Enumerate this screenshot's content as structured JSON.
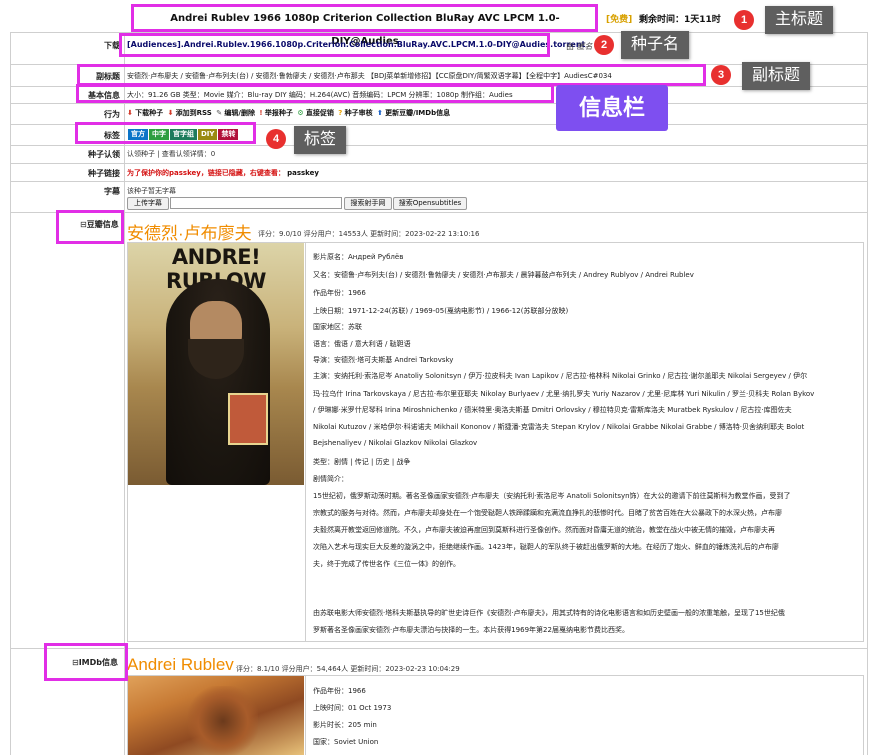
{
  "header": {
    "main_title": "Andrei Rublev 1966 1080p Criterion Collection BluRay AVC LPCM 1.0-DIY@Audies",
    "free_tag": "[免费]",
    "remaining_label": "剩余时间：",
    "remaining_value": "1天11时"
  },
  "annotations": {
    "main_title": "主标题",
    "torrent_name": "种子名",
    "subtitle": "副标题",
    "info_bar": "信息栏",
    "tags": "标签",
    "nums": [
      "1",
      "2",
      "3",
      "4"
    ]
  },
  "rows": {
    "download_label": "下载",
    "torrent_file": "[Audiences].Andrei.Rublev.1966.1080p.Criterion.Collection.BluRay.AVC.LPCM.1.0-DIY@Audies.torrent",
    "uploader_prefix": "由",
    "uploader_name": "匿名",
    "subtitle_label": "副标题",
    "subtitle_text": "安德烈·卢布廖夫 / 安德鲁·卢布列夫(台) / 安德烈·鲁勃廖夫 / 安德烈·卢布那夫 【BDJ菜单新增修招】【CC原盘DIY/简繁双语字幕】【全程中字】AudiesC#034",
    "info_label": "基本信息",
    "info_text": "大小：91.26 GB   类型：Movie   媒介：Blu-ray DIY   编码：H.264(AVC)   音频编码：LPCM   分辨率：1080p   制作组：Audies",
    "action_label": "行为",
    "actions": [
      "下载种子",
      "添加到RSS",
      "编辑/删除",
      "举报种子",
      "直接促销",
      "种子审核",
      "更新豆瓣/IMDb信息"
    ],
    "tags_label": "标签",
    "tags": [
      {
        "text": "官方",
        "color": "#0b74c8"
      },
      {
        "text": "中字",
        "color": "#2e9e40"
      },
      {
        "text": "官字组",
        "color": "#1d7b5c"
      },
      {
        "text": "DIY",
        "color": "#9a8a12"
      },
      {
        "text": "禁转",
        "color": "#b1113a"
      }
    ],
    "claim_label": "种子认领",
    "claim_text": "认领种子 | 查看认领详情：0",
    "link_label": "种子链接",
    "link_warning": "为了保护你的passkey，链接已隐藏，右键查看：",
    "link_value": "passkey",
    "subs_label": "字幕",
    "subs_none": "该种子暂无字幕",
    "upload_sub_btn": "上传字幕",
    "search_sub_btn": "搜索射手网",
    "search_opensub_btn": "搜索Opensubtitles"
  },
  "douban": {
    "section_label": "豆瓣信息",
    "title": "安德烈·卢布廖夫",
    "rating_text": "评分：9.0/10  评分用户：14553人  更新时间：2023-02-22 13:10:16",
    "poster_title": "ANDRE! RUBLOW",
    "lines": [
      "影片原名：Андрей Рублёв",
      "又名：安德鲁·卢布列夫(台) / 安德烈·鲁勃廖夫 / 安德烈·卢布那夫 / 晨钟暮鼓卢布列夫 / Andrey Rublyov / Andrei Rublev",
      "作品年份：1966",
      "上映日期：1971-12-24(苏联) / 1969-05(戛纳电影节) / 1966-12(苏联部分放映)",
      "国家地区：苏联",
      "语言：俄语 / 意大利语 / 鞑靼语",
      "导演：安德烈·塔可夫斯基 Andrei Tarkovsky",
      "主演：安纳托利·索洛尼岑 Anatoliy Solonitsyn / 伊万·拉皮科夫 Ivan Lapikov / 尼古拉·格林科 Nikolai Grinko / 尼古拉·谢尔盖耶夫 Nikolai Sergeyev / 伊尔",
      "玛·拉乌什 Irina Tarkovskaya / 尼古拉·布尔里亚耶夫 Nikolay Burlyaev / 尤里·纳扎罗夫 Yuriy Nazarov / 尤里·尼库林 Yuri Nikulin / 罗兰·贝科夫 Rolan Bykov",
      "/ 伊琳娜·米罗什尼琴科 Irina Miroshnichenko / 德米特里·奥洛夫斯基 Dmitri Orlovsky / 穆拉特贝克·雷斯库洛夫 Muratbek Ryskulov / 尼古拉·库图佐夫",
      "Nikolai Kutuzov / 米哈伊尔·科诺诺夫 Mikhail Kononov / 斯捷潘·克雷洛夫 Stepan Krylov / Nikolai Grabbe Nikolai Grabbe / 博洛特·贝舍纳利耶夫 Bolot",
      "Bejshenaliyev / Nikolai Glazkov Nikolai Glazkov",
      "类型：剧情 | 传记 | 历史 | 战争",
      "剧情简介："
    ],
    "synopsis": [
      "15世纪初，俄罗斯动荡时期。著名圣像画家安德烈·卢布廖夫（安纳托利·索洛尼岑 Anatoli Solonitsyn饰）在大公的邀请下前往莫斯科为教堂作画，受到了",
      "宗教式的服务与对待。然而，卢布廖夫却身处在一个饱受鞑靼人铁蹄蹂躏和充满流血挣扎的悲惨时代。目睹了贫苦百姓在大公暴政下的水深火热，卢布廖",
      "夫毅然离开教堂返回修道院。不久，卢布廖夫被迫再度回到莫斯科进行圣像创作。然而面对昏庸无道的统治，教堂在战火中被无情的摧毁，卢布廖夫再",
      "次陷入艺术与现实巨大反差的漩涡之中，拒绝继续作画。1423年，鞑靼人的军队终于被赶出俄罗斯的大地。在经历了炮火、鲜血的锤炼洗礼后的卢布廖",
      "夫，终于完成了传世名作《三位一体》的创作。"
    ],
    "review": [
      "由苏联电影大师安德烈·塔科夫斯基执导的旷世史诗巨作《安德烈·卢布廖夫》，用其式特有的诗化电影语言和如历史壁画一般的浓重笔触，呈现了15世纪俄",
      "罗斯著名圣像画家安德烈·卢布廖夫漂泊与抉择的一生。本片获得1969年第22届戛纳电影节费比西奖。"
    ]
  },
  "imdb": {
    "section_label": "IMDb信息",
    "title": "Andrei Rublev",
    "rating_text": "评分：8.1/10  评分用户：54,464人  更新时间：2023-02-23 10:04:29",
    "lines": [
      "作品年份：1966",
      "上映时间：01 Oct 1973",
      "影片时长：205 min",
      "国家：Soviet Union"
    ]
  }
}
